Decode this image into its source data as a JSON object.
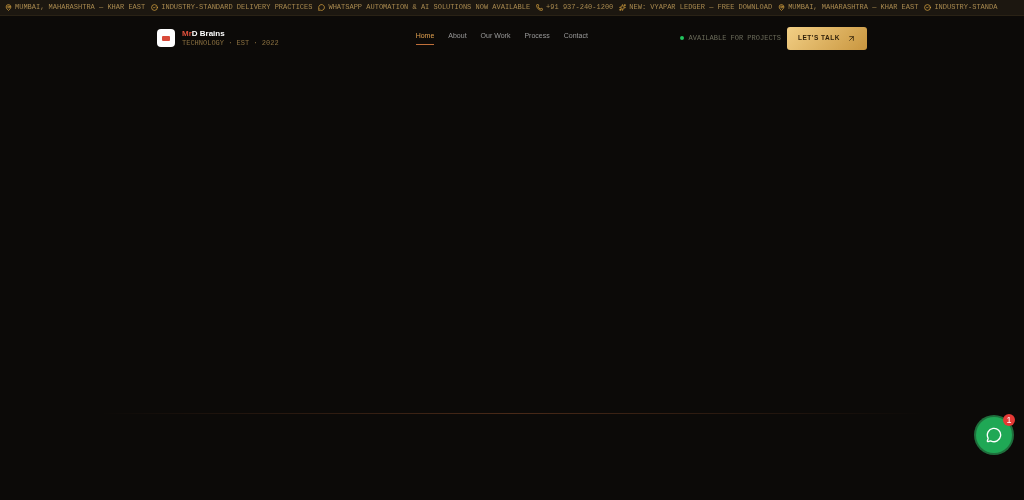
{
  "ticker": [
    {
      "kind": "pin",
      "text": "MUMBAI, MAHARASHTRA — KHAR EAST"
    },
    {
      "kind": "check",
      "text": "INDUSTRY-STANDARD DELIVERY PRACTICES"
    },
    {
      "kind": "chat",
      "text": "WHATSAPP AUTOMATION & AI SOLUTIONS NOW AVAILABLE"
    },
    {
      "kind": "phone",
      "text": "+91 937-240-1200"
    },
    {
      "kind": "spark",
      "text": "NEW: VYAPAR LEDGER — FREE DOWNLOAD"
    },
    {
      "kind": "pin",
      "text": "MUMBAI, MAHARASHTRA — KHAR EAST"
    },
    {
      "kind": "check",
      "text": "INDUSTRY-STANDA"
    }
  ],
  "brand": {
    "name_accent": "Mr",
    "name": "D Brains",
    "tagline": "TECHNOLOGY · EST · 2022"
  },
  "nav": [
    {
      "label": "Home",
      "selected": true
    },
    {
      "label": "About",
      "selected": false
    },
    {
      "label": "Our Work",
      "selected": false
    },
    {
      "label": "Process",
      "selected": false
    },
    {
      "label": "Contact",
      "selected": false
    }
  ],
  "availability": {
    "text": "AVAILABLE FOR PROJECTS",
    "color": "#22c55e"
  },
  "cta": {
    "label": "LET'S TALK"
  },
  "chat_widget": {
    "badge": "1"
  }
}
